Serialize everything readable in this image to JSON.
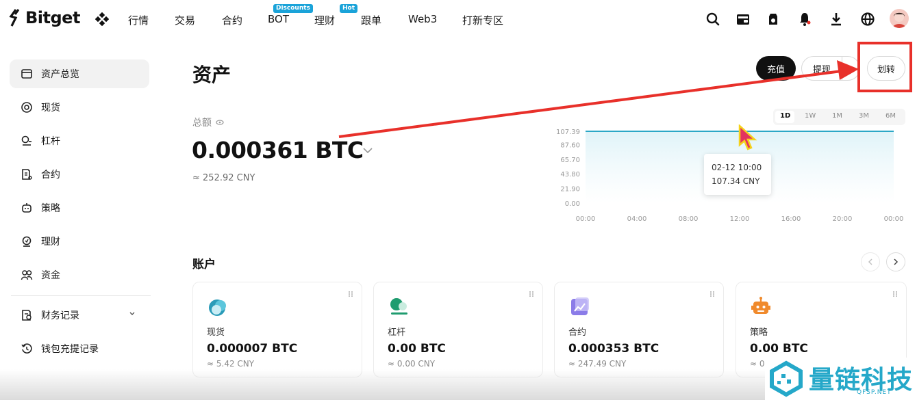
{
  "nav": {
    "brand": "Bitget",
    "items": [
      {
        "label": "行情"
      },
      {
        "label": "交易"
      },
      {
        "label": "合约"
      },
      {
        "label": "BOT",
        "badge": "Discounts"
      },
      {
        "label": "理财",
        "badge": "Hot"
      },
      {
        "label": "跟单"
      },
      {
        "label": "Web3"
      },
      {
        "label": "打新专区"
      }
    ],
    "icons": [
      "search-icon",
      "wallet-icon",
      "rewards-icon",
      "bell-icon",
      "download-icon",
      "globe-icon"
    ],
    "badge_color": "#1aa3d9"
  },
  "sidebar": {
    "items": [
      {
        "label": "资产总览",
        "icon": "asset-overview-icon",
        "active": true
      },
      {
        "label": "现货",
        "icon": "spot-icon"
      },
      {
        "label": "杠杆",
        "icon": "margin-icon"
      },
      {
        "label": "合约",
        "icon": "futures-icon"
      },
      {
        "label": "策略",
        "icon": "strategy-icon"
      },
      {
        "label": "理财",
        "icon": "earn-icon"
      },
      {
        "label": "资金",
        "icon": "funding-icon"
      },
      {
        "label": "财务记录",
        "icon": "records-icon",
        "expandable": true
      },
      {
        "label": "钱包充提记录",
        "icon": "history-icon"
      }
    ]
  },
  "header": {
    "title": "资产",
    "deposit_label": "充值",
    "withdraw_label": "提现",
    "transfer_label": "划转",
    "highlight_color": "#e8302a"
  },
  "total": {
    "label": "总额",
    "value": "0.000361 BTC",
    "cny": "≈ 252.92 CNY"
  },
  "chart": {
    "ranges": [
      "1D",
      "1W",
      "1M",
      "3M",
      "6M"
    ],
    "selected_range": "1D",
    "tooltip_time": "02-12 10:00",
    "tooltip_value": "107.34 CNY"
  },
  "chart_data": {
    "type": "area",
    "x": [
      "00:00",
      "04:00",
      "08:00",
      "12:00",
      "16:00",
      "20:00",
      "00:00"
    ],
    "y_ticks": [
      "107.39",
      "87.60",
      "65.70",
      "43.80",
      "21.90",
      "0.00"
    ],
    "ylim": [
      0,
      107.39
    ],
    "series": [
      {
        "values": [
          107.34,
          107.34,
          107.34,
          107.34,
          107.34,
          107.34,
          107.34
        ]
      }
    ],
    "line_color": "#2ba7c6",
    "fill_color": "#dff3f8"
  },
  "accounts": {
    "title": "账户",
    "cards": [
      {
        "name": "现货",
        "value": "0.000007 BTC",
        "cny": "≈ 5.42 CNY",
        "icon": "spot-account-icon"
      },
      {
        "name": "杠杆",
        "value": "0.00 BTC",
        "cny": "≈ 0.00 CNY",
        "icon": "margin-account-icon"
      },
      {
        "name": "合约",
        "value": "0.000353 BTC",
        "cny": "≈ 247.49 CNY",
        "icon": "futures-account-icon"
      },
      {
        "name": "策略",
        "value": "0.00 BTC",
        "cny": "≈ 0.0",
        "icon": "strategy-account-icon"
      }
    ]
  },
  "watermark": {
    "text": "量链科技",
    "sub": "QFSP.NET"
  }
}
